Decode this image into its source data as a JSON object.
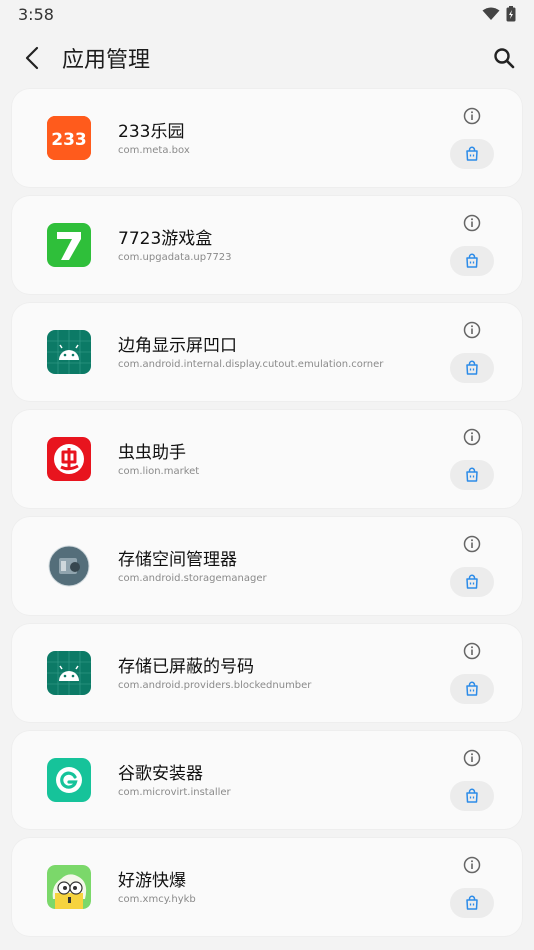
{
  "status": {
    "time": "3:58"
  },
  "header": {
    "title": "应用管理"
  },
  "apps": [
    {
      "name": "233乐园",
      "package": "com.meta.box",
      "icon": "233-icon"
    },
    {
      "name": "7723游戏盒",
      "package": "com.upgadata.up7723",
      "icon": "7723-icon"
    },
    {
      "name": "边角显示屏凹口",
      "package": "com.android.internal.display.cutout.emulation.corner",
      "icon": "android-icon"
    },
    {
      "name": "虫虫助手",
      "package": "com.lion.market",
      "icon": "chongchong-icon"
    },
    {
      "name": "存储空间管理器",
      "package": "com.android.storagemanager",
      "icon": "storage-icon"
    },
    {
      "name": "存储已屏蔽的号码",
      "package": "com.android.providers.blockednumber",
      "icon": "android-icon"
    },
    {
      "name": "谷歌安装器",
      "package": "com.microvirt.installer",
      "icon": "google-installer-icon"
    },
    {
      "name": "好游快爆",
      "package": "com.xmcy.hykb",
      "icon": "haoyou-icon"
    }
  ]
}
